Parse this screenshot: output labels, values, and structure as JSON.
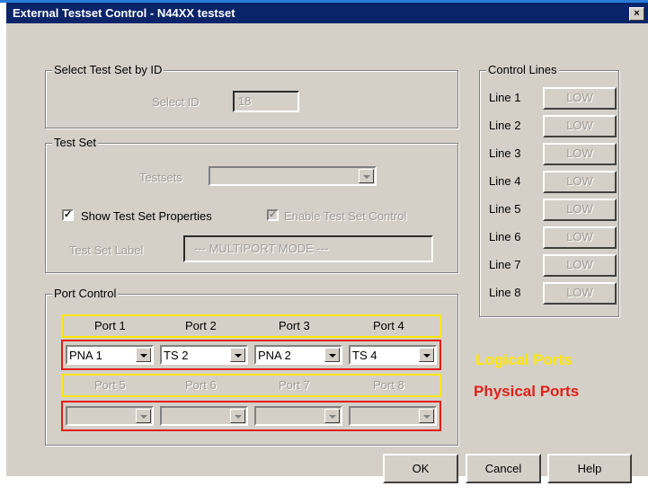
{
  "window": {
    "title": "External Testset Control - N44XX testset",
    "close_label": "×"
  },
  "select_by_id": {
    "legend": "Select Test Set by ID",
    "label": "Select ID",
    "value": "18"
  },
  "test_set": {
    "legend": "Test Set",
    "testsets_label": "Testsets",
    "testsets_value": "",
    "show_props_label": "Show Test Set Properties",
    "show_props_checked": "✓",
    "enable_control_label": "Enable Test Set Control",
    "enable_control_checked": "✓",
    "label_caption": "Test Set Label",
    "label_value": "--- MULTIPORT MODE ---"
  },
  "port_control": {
    "legend": "Port Control",
    "top_ports": [
      "Port 1",
      "Port 2",
      "Port 3",
      "Port 4"
    ],
    "top_values": [
      "PNA 1",
      "TS 2",
      "PNA 2",
      "TS 4"
    ],
    "bottom_ports": [
      "Port 5",
      "Port 6",
      "Port 7",
      "Port 8"
    ],
    "bottom_values": [
      "",
      "",
      "",
      ""
    ],
    "logical_label": "Logical Ports",
    "physical_label": "Physical Ports"
  },
  "control_lines": {
    "legend": "Control Lines",
    "lines": [
      {
        "label": "Line 1",
        "state": "LOW"
      },
      {
        "label": "Line 2",
        "state": "LOW"
      },
      {
        "label": "Line 3",
        "state": "LOW"
      },
      {
        "label": "Line 4",
        "state": "LOW"
      },
      {
        "label": "Line 5",
        "state": "LOW"
      },
      {
        "label": "Line 6",
        "state": "LOW"
      },
      {
        "label": "Line 7",
        "state": "LOW"
      },
      {
        "label": "Line 8",
        "state": "LOW"
      }
    ]
  },
  "buttons": {
    "ok": "OK",
    "cancel": "Cancel",
    "help": "Help"
  },
  "colors": {
    "titlebar": "#0a246a",
    "logical": "#ffe600",
    "physical": "#e0201a",
    "face": "#d4d0c8"
  }
}
